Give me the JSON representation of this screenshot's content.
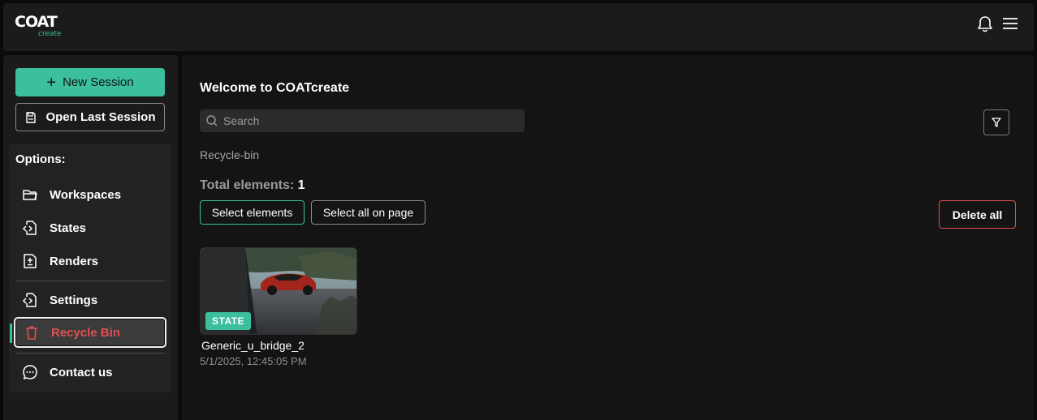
{
  "header": {
    "logo_main": "COAT",
    "logo_sub": "create",
    "notifications_icon": "bell-icon",
    "menu_icon": "hamburger-menu-icon"
  },
  "sidebar": {
    "new_session_label": "New Session",
    "open_last_session_label": "Open Last Session",
    "options_title": "Options:",
    "items": [
      {
        "label": "Workspaces",
        "icon": "folder-icon"
      },
      {
        "label": "States",
        "icon": "code-file-icon"
      },
      {
        "label": "Renders",
        "icon": "plus-minus-file-icon"
      },
      {
        "label": "Settings",
        "icon": "code-file-icon"
      },
      {
        "label": "Recycle Bin",
        "icon": "trash-icon",
        "active": true
      },
      {
        "label": "Contact us",
        "icon": "chat-bubble-icon"
      }
    ]
  },
  "main": {
    "welcome": "Welcome to COATcreate",
    "search_placeholder": "Search",
    "breadcrumb": "Recycle-bin",
    "total_label": "Total elements:",
    "total_count": "1",
    "select_elements_label": "Select elements",
    "select_all_label": "Select all on page",
    "delete_all_label": "Delete all",
    "cards": [
      {
        "badge": "STATE",
        "title": "Generic_u_bridge_2",
        "date": "5/1/2025, 12:45:05 PM"
      }
    ]
  },
  "colors": {
    "accent": "#3bbf9c",
    "danger": "#e05050",
    "background": "#0b0b0b",
    "panel": "#1b1b1b"
  }
}
